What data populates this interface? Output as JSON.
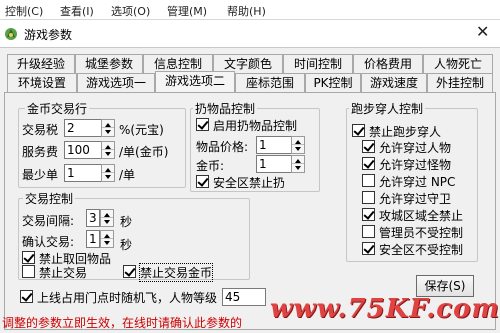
{
  "menubar": {
    "items": [
      "控制(C)",
      "查看(I)",
      "选项(O)",
      "管理(M)",
      "帮助(H)"
    ]
  },
  "window": {
    "title": "游戏参数"
  },
  "tabs": {
    "row1": [
      "升级经验",
      "城堡参数",
      "信息控制",
      "文字颜色",
      "时间控制",
      "价格费用",
      "人物死亡"
    ],
    "row2": [
      "环境设置",
      "游戏选项一",
      "游戏选项二",
      "座标范围",
      "PK控制",
      "游戏速度",
      "外挂控制"
    ],
    "active": "游戏选项二"
  },
  "gold_trade": {
    "legend": "金币交易行",
    "tax_label": "交易税",
    "tax_value": "2",
    "tax_unit": "%(元宝)",
    "fee_label": "服务费",
    "fee_value": "100",
    "fee_unit": "/单(金币)",
    "min_label": "最少单",
    "min_value": "1",
    "min_unit": "/单"
  },
  "item_control": {
    "legend": "扔物品控制",
    "enable_label": "启用扔物品控制",
    "enable_checked": true,
    "price_label": "物品价格:",
    "price_value": "1",
    "gold_label": "金币:",
    "gold_value": "1",
    "safezone_label": "安全区禁止扔",
    "safezone_checked": true
  },
  "trade_control": {
    "legend": "交易控制",
    "interval_label": "交易间隔:",
    "interval_value": "3",
    "interval_unit": "秒",
    "confirm_label": "确认交易:",
    "confirm_value": "1",
    "confirm_unit": "秒",
    "ban_retrieve_label": "禁止取回物品",
    "ban_retrieve_checked": true,
    "ban_trade_label": "禁止交易",
    "ban_trade_checked": false,
    "ban_gold_label": "禁止交易金币",
    "ban_gold_checked": true
  },
  "walk_through": {
    "legend": "跑步穿人控制",
    "options": [
      {
        "label": "禁止跑步穿人",
        "checked": true
      },
      {
        "label": "允许穿过人物",
        "checked": true
      },
      {
        "label": "允许穿过怪物",
        "checked": true
      },
      {
        "label": "允许穿过 NPC",
        "checked": false
      },
      {
        "label": "允许穿过守卫",
        "checked": false
      },
      {
        "label": "攻城区域全禁止",
        "checked": true
      },
      {
        "label": "管理员不受控制",
        "checked": false
      },
      {
        "label": "安全区不受控制",
        "checked": true
      }
    ]
  },
  "online_random": {
    "label": "上线占用门点时随机飞，人物等级",
    "checked": true,
    "value": "45"
  },
  "save_label": "保存(S)",
  "status_text": "调整的参数立即生效，在线时请确认此参数的",
  "watermark": "www.75KF.com"
}
